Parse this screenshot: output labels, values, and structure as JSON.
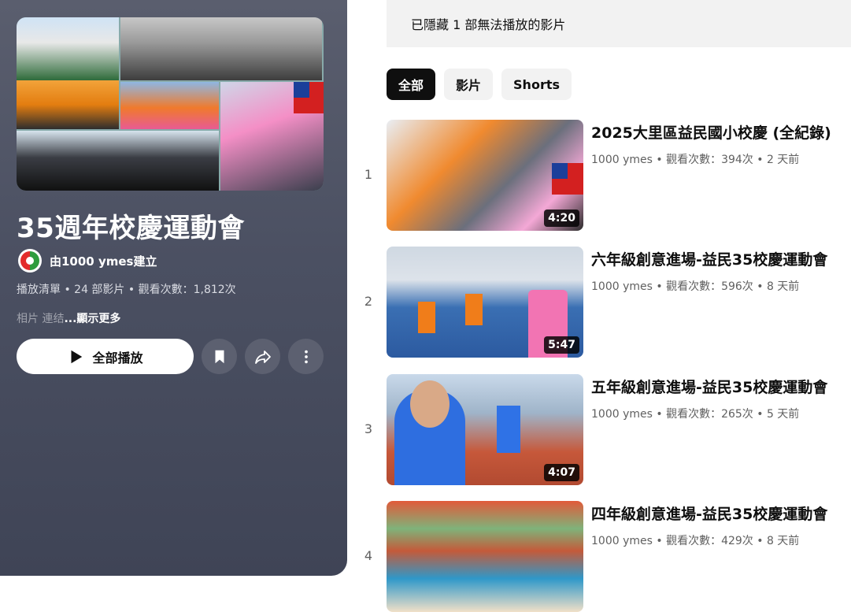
{
  "playlist": {
    "title": "35週年校慶運動會",
    "creator": "由1000 ymes建立",
    "meta": "播放清單 • 24 部影片 • 觀看次數：1,812次",
    "desc_prefix": "相片 連结",
    "show_more": "...顯示更多",
    "play_all_label": "全部播放"
  },
  "banner": {
    "text": "已隱藏 1 部無法播放的影片"
  },
  "chips": [
    "全部",
    "影片",
    "Shorts"
  ],
  "videos": [
    {
      "index": "1",
      "title": "2025大里區益民國小校慶 (全紀錄)",
      "meta": "1000 ymes • 觀看次數：394次 • 2 天前",
      "duration": "4:20"
    },
    {
      "index": "2",
      "title": "六年級創意進場-益民35校慶運動會",
      "meta": "1000 ymes • 觀看次數：596次 • 8 天前",
      "duration": "5:47"
    },
    {
      "index": "3",
      "title": "五年級創意進場-益民35校慶運動會",
      "meta": "1000 ymes • 觀看次數：265次 • 5 天前",
      "duration": "4:07"
    },
    {
      "index": "4",
      "title": "四年級創意進場-益民35校慶運動會",
      "meta": "1000 ymes • 觀看次數：429次 • 8 天前",
      "duration": ""
    }
  ],
  "icons": {
    "play": "play-icon",
    "save": "bookmark-icon",
    "share": "share-icon",
    "more": "more-vert-icon"
  }
}
